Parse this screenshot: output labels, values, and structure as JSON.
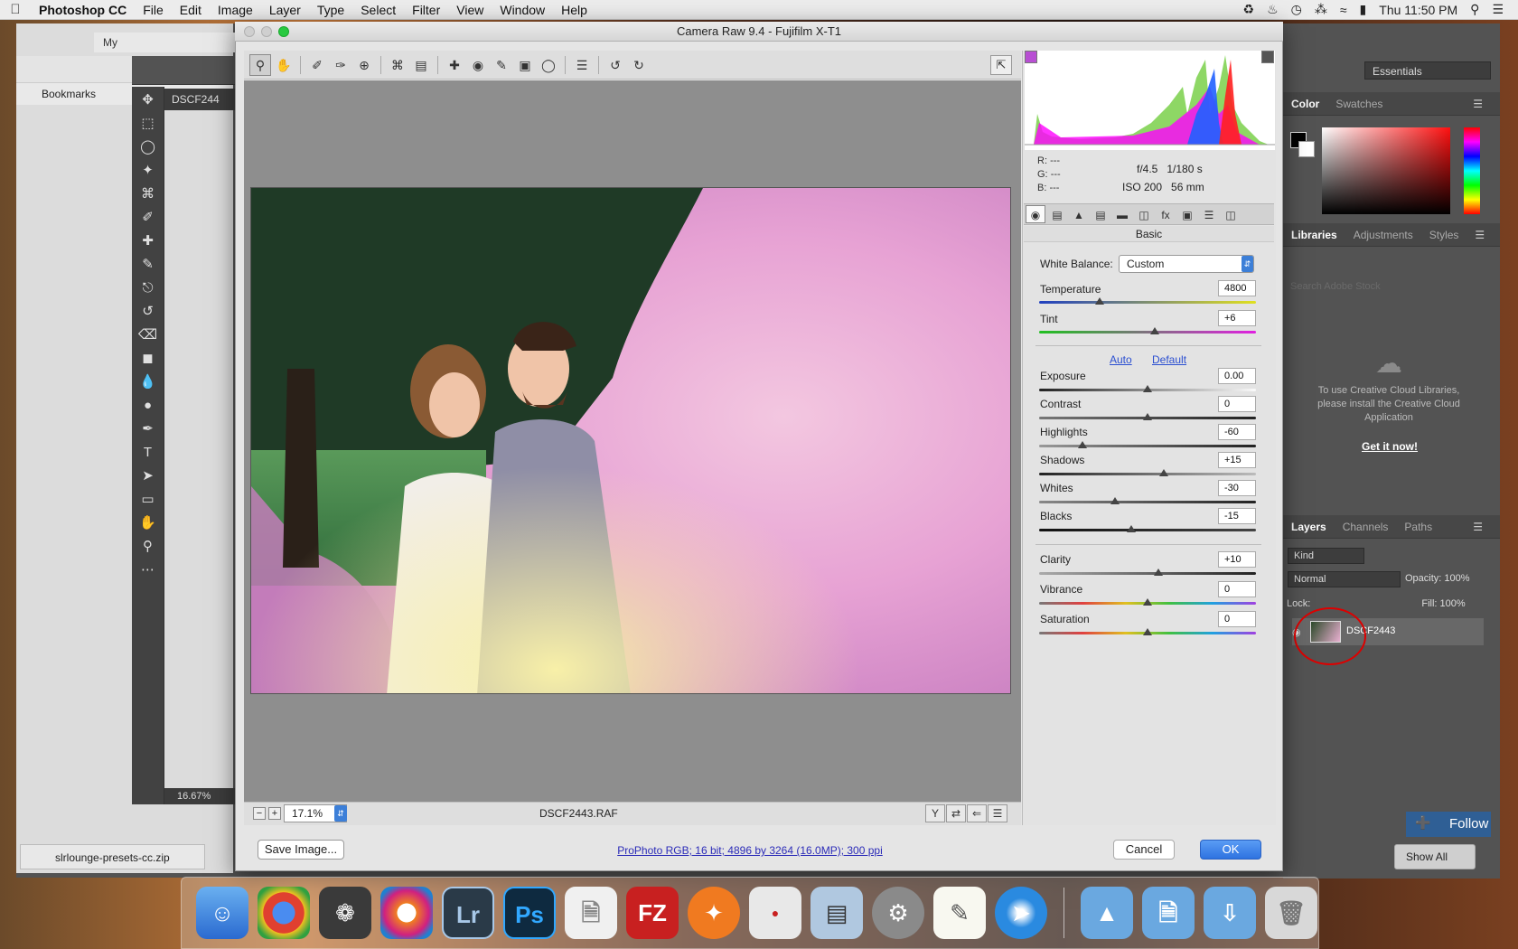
{
  "menubar": {
    "app_name": "Photoshop CC",
    "items": [
      "File",
      "Edit",
      "Image",
      "Layer",
      "Type",
      "Select",
      "Filter",
      "View",
      "Window",
      "Help"
    ],
    "clock": "Thu 11:50 PM"
  },
  "browser": {
    "tab_title": "My",
    "bookmarks_label": "Bookmarks",
    "download_file": "slrlounge-presets-cc.zip",
    "show_all": "Show All",
    "follow": "Follow"
  },
  "photoshop": {
    "doc_tab": "DSCF244",
    "zoom_status": "16.67%",
    "workspace": "Essentials",
    "color_panel": {
      "tabs": [
        "Color",
        "Swatches"
      ],
      "active": "Color"
    },
    "libraries_panel": {
      "tabs": [
        "Libraries",
        "Adjustments",
        "Styles"
      ],
      "active": "Libraries",
      "search_placeholder": "Search Adobe Stock",
      "message": "To use Creative Cloud Libraries, please install the Creative Cloud Application",
      "cta": "Get it now!"
    },
    "layers_panel": {
      "tabs": [
        "Layers",
        "Channels",
        "Paths"
      ],
      "active": "Layers",
      "kind": "Kind",
      "blend_mode": "Normal",
      "opacity_label": "Opacity:",
      "opacity": "100%",
      "lock_label": "Lock:",
      "fill_label": "Fill:",
      "fill": "100%",
      "layer_name": "DSCF2443"
    }
  },
  "camera_raw": {
    "title": "Camera Raw 9.4  -  Fujifilm X-T1",
    "zoom": "17.1%",
    "file_name": "DSCF2443.RAF",
    "rgb": {
      "r_label": "R:",
      "g_label": "G:",
      "b_label": "B:",
      "r": "---",
      "g": "---",
      "b": "---"
    },
    "exif": {
      "aperture": "f/4.5",
      "shutter": "1/180 s",
      "iso": "ISO 200",
      "focal": "56 mm"
    },
    "panel_title": "Basic",
    "white_balance_label": "White Balance:",
    "white_balance": "Custom",
    "auto_label": "Auto",
    "default_label": "Default",
    "sliders": {
      "temperature": {
        "label": "Temperature",
        "value": "4800"
      },
      "tint": {
        "label": "Tint",
        "value": "+6"
      },
      "exposure": {
        "label": "Exposure",
        "value": "0.00"
      },
      "contrast": {
        "label": "Contrast",
        "value": "0"
      },
      "highlights": {
        "label": "Highlights",
        "value": "-60"
      },
      "shadows": {
        "label": "Shadows",
        "value": "+15"
      },
      "whites": {
        "label": "Whites",
        "value": "-30"
      },
      "blacks": {
        "label": "Blacks",
        "value": "-15"
      },
      "clarity": {
        "label": "Clarity",
        "value": "+10"
      },
      "vibrance": {
        "label": "Vibrance",
        "value": "0"
      },
      "saturation": {
        "label": "Saturation",
        "value": "0"
      }
    },
    "save_button": "Save Image...",
    "workflow_options": "ProPhoto RGB; 16 bit; 4896 by 3264 (16.0MP); 300 ppi",
    "cancel_button": "Cancel",
    "ok_button": "OK"
  },
  "dock": {
    "lightroom": "Lr",
    "photoshop": "Ps",
    "filezilla": "FZ"
  },
  "colors": {
    "ok_blue": "#2e73e0",
    "link_blue": "#2b4fd1",
    "annotation_red": "#dd0000",
    "follow_blue": "#2f5f95"
  }
}
